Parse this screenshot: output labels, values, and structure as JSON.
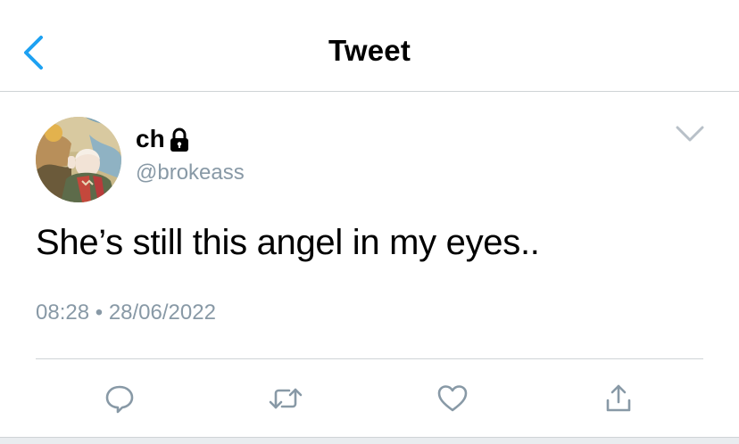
{
  "header": {
    "title": "Tweet",
    "back_icon": "chevron-left-icon"
  },
  "tweet": {
    "display_name": "ch",
    "locked": true,
    "handle": "@brokeass",
    "text": "She’s still this angel in my eyes..",
    "time": "08:28",
    "separator": "•",
    "date": "28/06/2022"
  },
  "actions": [
    {
      "icon": "reply-icon"
    },
    {
      "icon": "retweet-icon"
    },
    {
      "icon": "like-icon"
    },
    {
      "icon": "share-icon"
    }
  ],
  "colors": {
    "accent": "#1da1f2",
    "secondary_text": "#8899a6",
    "divider": "#cfd3d6"
  }
}
